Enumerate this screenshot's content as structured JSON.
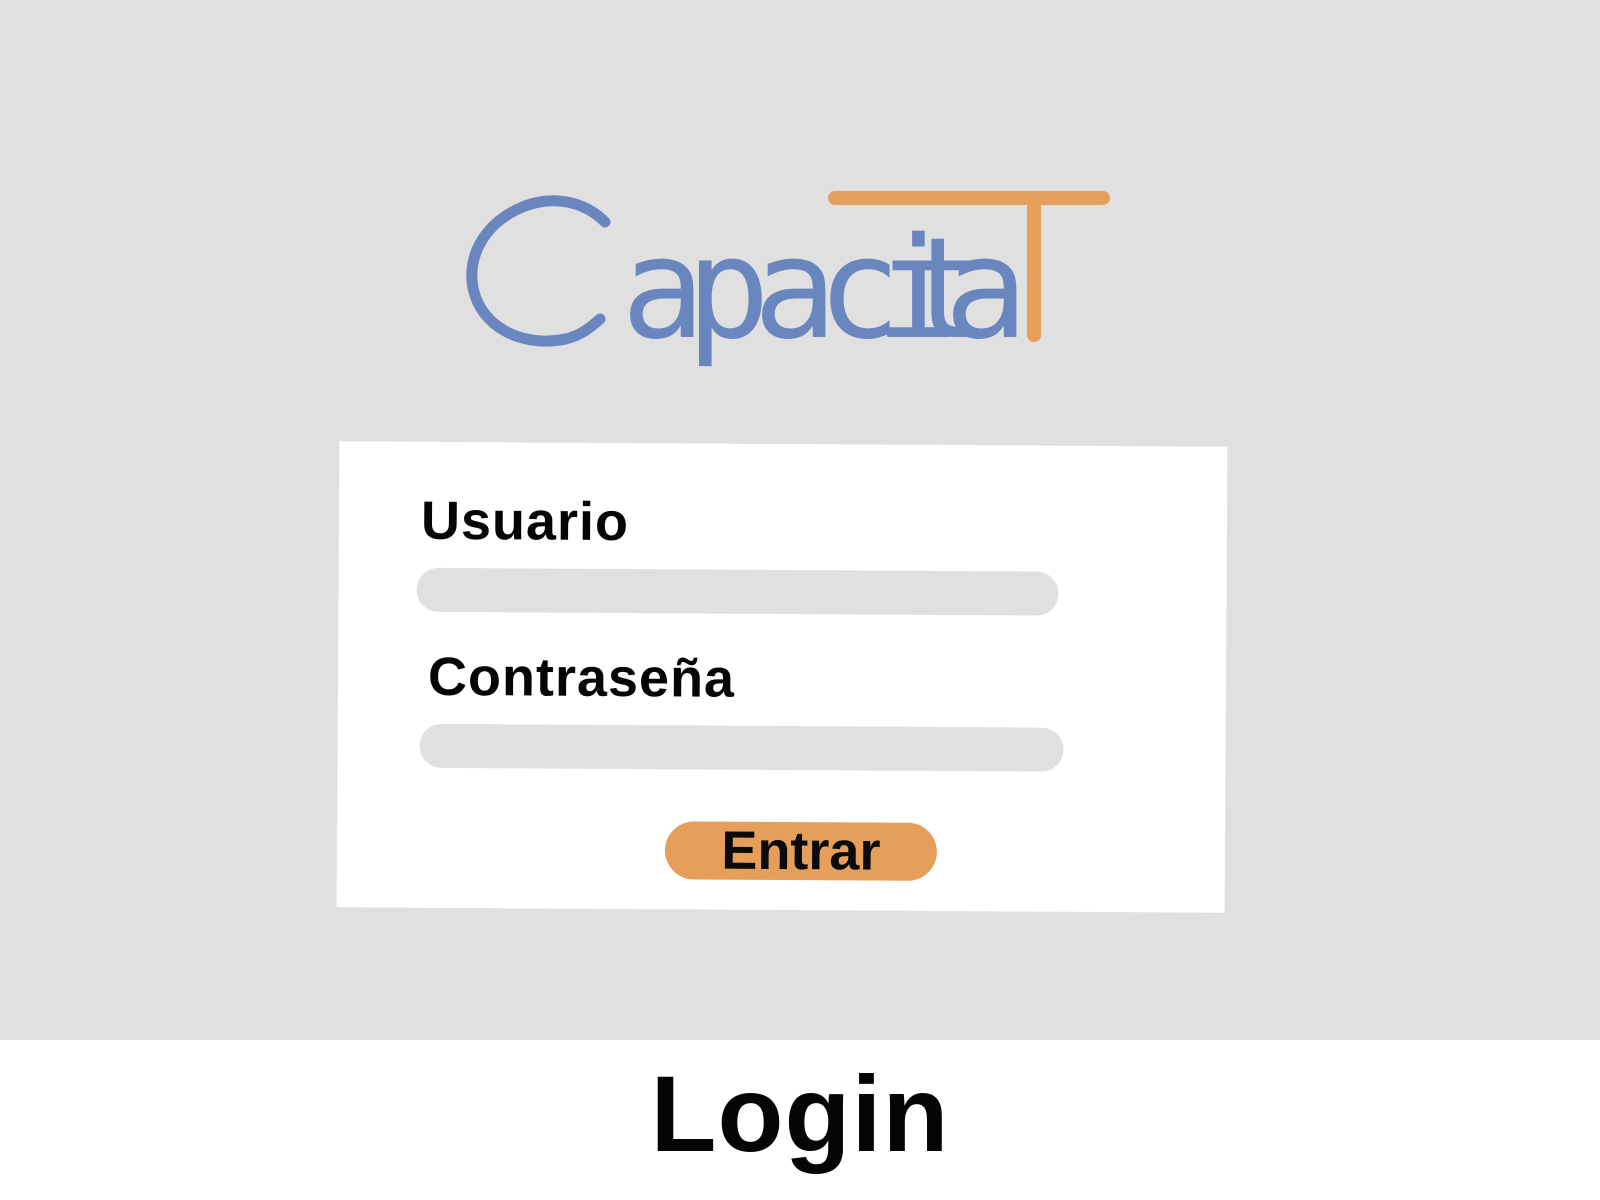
{
  "logo": {
    "letters": [
      "C",
      "a",
      "p",
      "a",
      "c",
      "i",
      "t",
      "a",
      "T"
    ],
    "text": "CapacitaT",
    "color_primary": "#6a86bf",
    "color_accent": "#e69f5a",
    "icon": "capacitat-logo-icon"
  },
  "login": {
    "user_label": "Usuario",
    "user_value": "",
    "password_label": "Contraseña",
    "password_value": "",
    "submit_label": "Entrar"
  },
  "caption": {
    "title": "Login"
  },
  "colors": {
    "background": "#e0e0e0",
    "card": "#ffffff",
    "field": "#e0e0e0",
    "button": "#e69f5a",
    "text": "#050505"
  }
}
